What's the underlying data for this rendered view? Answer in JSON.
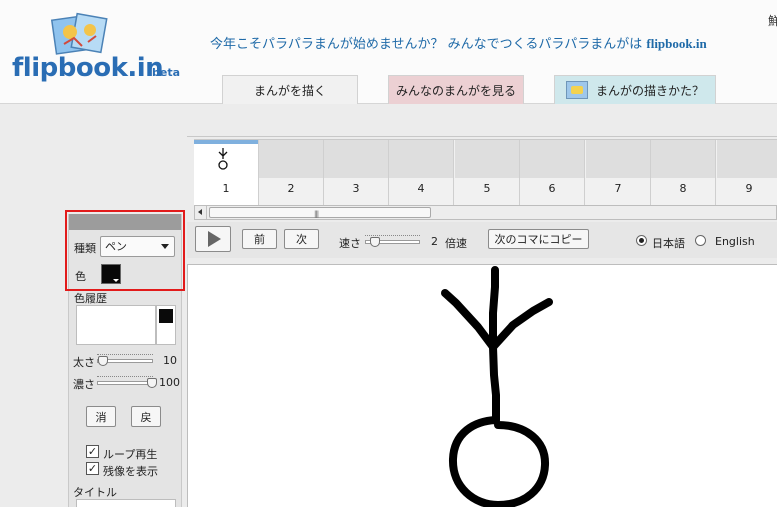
{
  "header": {
    "logo_text": "flipbook.in",
    "logo_beta": "beta",
    "tagline": "今年こそパラパラまんが始めませんか？ みんなでつくるパラパラまんがは",
    "tagline_site": "flipbook.in",
    "corner_char": "鮮"
  },
  "tabs": {
    "draw": "まんがを描く",
    "view": "みんなのまんがを見る",
    "howto": "まんがの描きかた？"
  },
  "left_panel": {
    "type_label": "種類",
    "tool_value": "ペン",
    "color_label": "色",
    "color_value": "#080808",
    "history_label": "色履歴",
    "thickness_label": "太さ",
    "thickness_value": "10",
    "opacity_label": "濃さ",
    "opacity_value": "100",
    "erase_label": "消",
    "undo_label": "戻",
    "loop_label": "ループ再生",
    "loop_checked": true,
    "onion_label": "残像を表示",
    "onion_checked": true,
    "title_label": "タイトル"
  },
  "filmstrip": {
    "frames": [
      "1",
      "2",
      "3",
      "4",
      "5",
      "6",
      "7",
      "8",
      "9"
    ],
    "active_frame": "1"
  },
  "toolbar": {
    "prev_label": "前",
    "next_label": "次",
    "speed_label": "速さ",
    "speed_value": "2",
    "speed_unit": "倍速",
    "copy_label": "次のコマにコピー",
    "lang_ja": "日本語",
    "lang_en": "English",
    "lang_selected": "日本語"
  }
}
